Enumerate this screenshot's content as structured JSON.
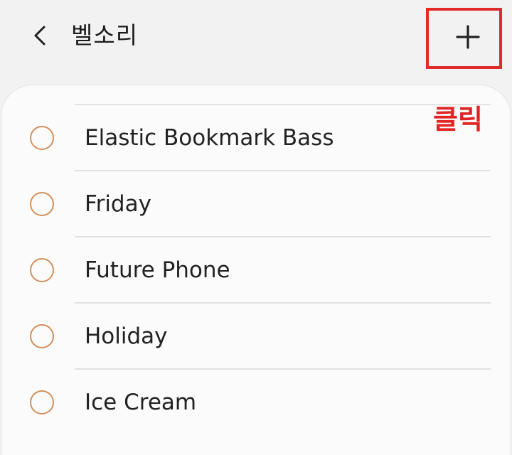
{
  "header": {
    "title": "벨소리",
    "back_icon": "chevron-left-icon",
    "add_icon": "plus-icon"
  },
  "annotation": {
    "text": "클릭",
    "color": "#e02424"
  },
  "ringtones": [
    {
      "label": "Elastic Bookmark Bass",
      "selected": false
    },
    {
      "label": "Friday",
      "selected": false
    },
    {
      "label": "Future Phone",
      "selected": false
    },
    {
      "label": "Holiday",
      "selected": false
    },
    {
      "label": "Ice Cream",
      "selected": false
    }
  ],
  "colors": {
    "radio_accent": "#d28f5b",
    "highlight": "#e12a2a",
    "background": "#f2f2f2",
    "card": "#fcfbfb"
  }
}
